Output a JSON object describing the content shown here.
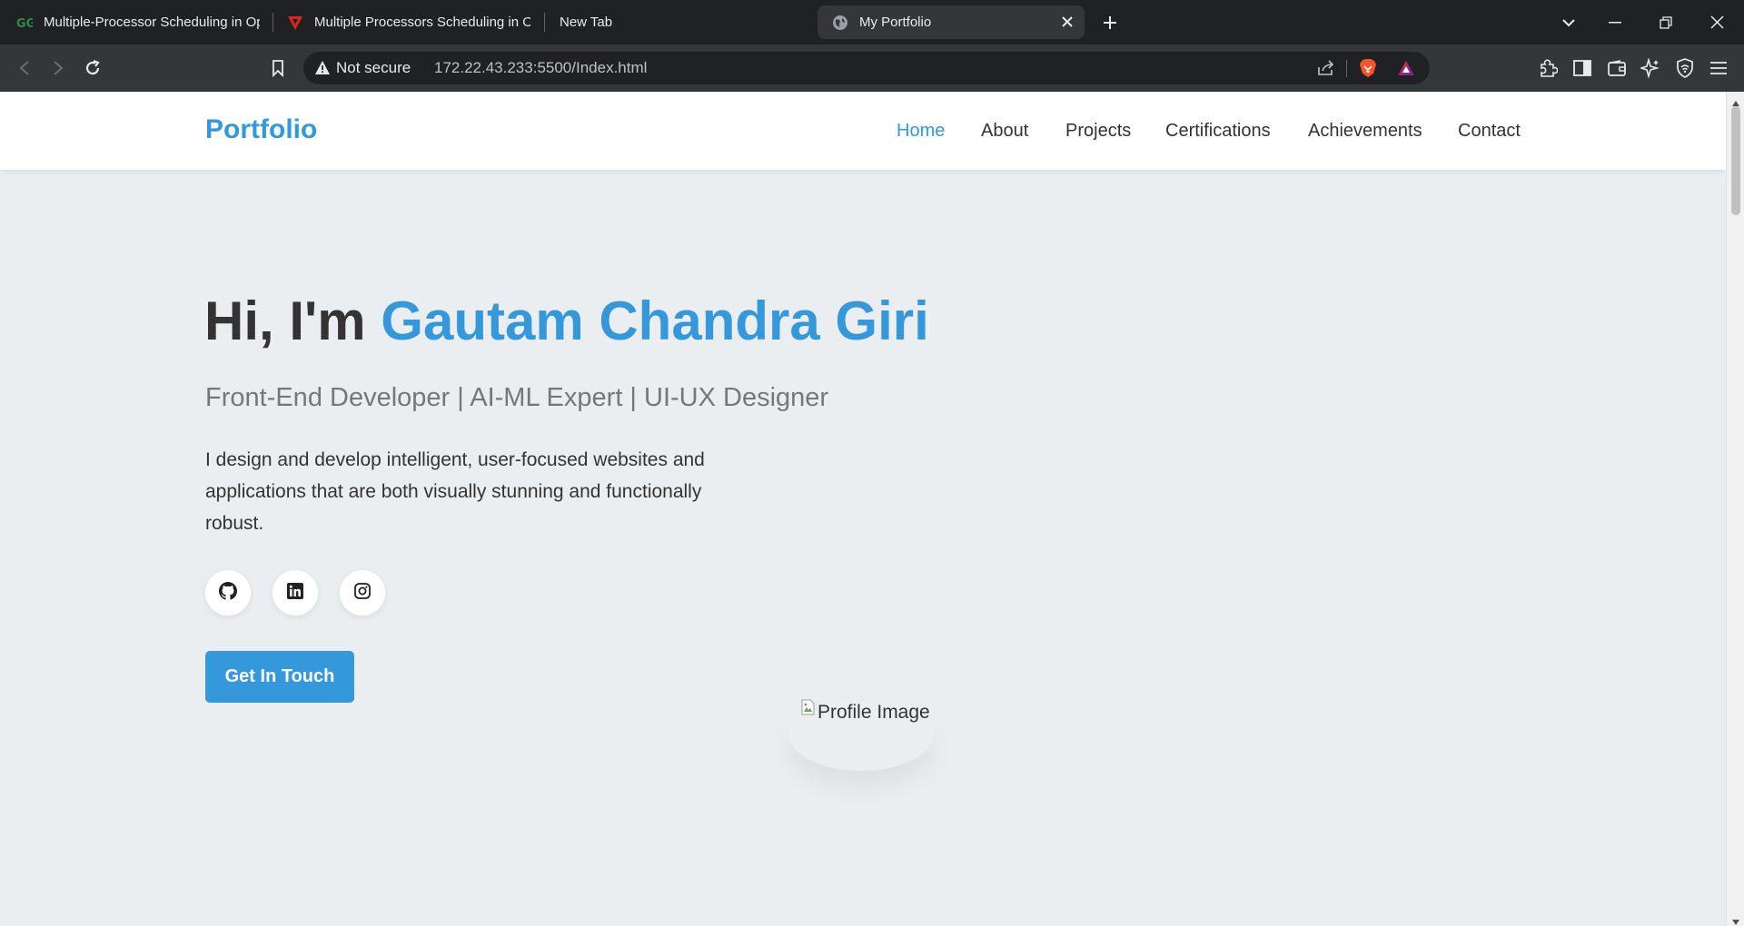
{
  "browser": {
    "tabs": [
      {
        "title": "Multiple-Processor Scheduling in Operating System",
        "icon": "geeksforgeeks-icon",
        "active": false
      },
      {
        "title": "Multiple Processors Scheduling in Operating System",
        "icon": "vidyarthi-v-icon",
        "active": false
      },
      {
        "title": "New Tab",
        "icon": "",
        "active": false
      },
      {
        "title": "My Portfolio",
        "icon": "globe-icon",
        "active": true
      }
    ],
    "security_label": "Not secure",
    "url": "172.22.43.233:5500/Index.html"
  },
  "site": {
    "brand": "Portfolio",
    "nav": [
      {
        "label": "Home",
        "active": true
      },
      {
        "label": "About",
        "active": false
      },
      {
        "label": "Projects",
        "active": false
      },
      {
        "label": "Certifications",
        "active": false
      },
      {
        "label": "Achievements",
        "active": false
      },
      {
        "label": "Contact",
        "active": false
      }
    ],
    "hero": {
      "greeting": "Hi, I'm ",
      "name": "Gautam Chandra Giri",
      "subtitle": "Front-End Developer | AI-ML Expert | UI-UX Designer",
      "description": "I design and develop intelligent, user-focused websites and applications that are both visually stunning and functionally robust.",
      "social_icons": [
        "github-icon",
        "linkedin-icon",
        "instagram-icon"
      ],
      "cta_label": "Get In Touch",
      "profile_alt": "Profile Image"
    },
    "colors": {
      "accent": "#3498db",
      "text": "#333333",
      "muted": "#777777",
      "background": "#ebeef0"
    }
  }
}
